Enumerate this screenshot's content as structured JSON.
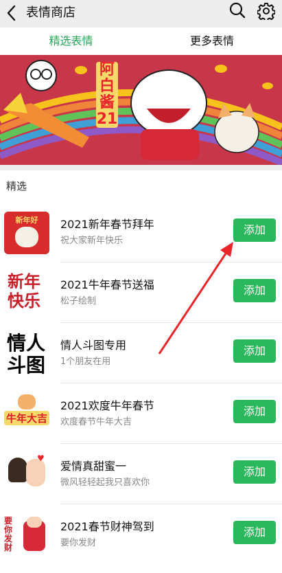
{
  "header": {
    "title": "表情商店"
  },
  "tabs": [
    {
      "label": "精选表情"
    },
    {
      "label": "更多表情"
    }
  ],
  "banner": {
    "text_line1": "阿",
    "text_line2": "白",
    "text_line3": "酱",
    "text_line4": "21"
  },
  "section": {
    "title": "精选"
  },
  "items": [
    {
      "name": "2021新年春节拜年",
      "subtitle": "祝大家新年快乐",
      "button": "添加",
      "thumb_text": "新年好"
    },
    {
      "name": "2021牛年春节送福",
      "subtitle": "松子绘制",
      "button": "添加",
      "thumb_text": "新年快乐"
    },
    {
      "name": "情人斗图专用",
      "subtitle": "1个朋友在用",
      "button": "添加",
      "thumb_text": "情人斗图"
    },
    {
      "name": "2021欢度牛年春节",
      "subtitle": "欢度春节牛年大吉",
      "button": "添加",
      "thumb_text": "牛年大吉"
    },
    {
      "name": "爱情真甜蜜一",
      "subtitle": "微风轻轻起我只喜欢你",
      "button": "添加",
      "thumb_text": ""
    },
    {
      "name": "2021春节财神驾到",
      "subtitle": "要你发财",
      "button": "添加",
      "thumb_text": "要你发财"
    }
  ],
  "colors": {
    "accent": "#2ab85c",
    "banner": "#c8364a",
    "arrow": "#e8262a"
  }
}
